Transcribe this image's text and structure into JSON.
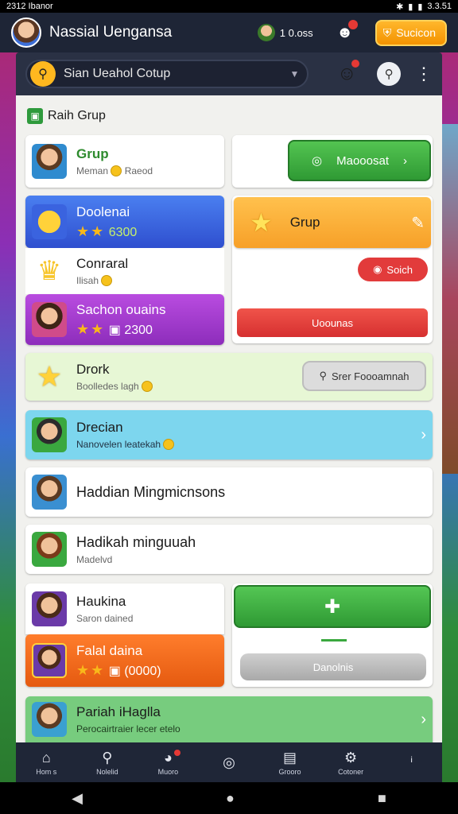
{
  "status_bar": {
    "time": "2312 Ibanor",
    "right": "3.3.51"
  },
  "header": {
    "title": "Nassial Uengansa",
    "coins": "1 0.oss",
    "action_label": "Sucicon"
  },
  "search": {
    "placeholder": "Sian Ueahol Cotup"
  },
  "section": {
    "title": "Raih Grup"
  },
  "cards": {
    "grup": {
      "title": "Grup",
      "subtitle": "Meman",
      "meta": "Raeod"
    },
    "masonat_button": "Maooosat",
    "doolenai": {
      "title": "Doolenai",
      "score": "6300"
    },
    "grup_orange": {
      "title": "Grup"
    },
    "conraral": {
      "title": "Conraral",
      "subtitle": "Ilisah"
    },
    "red_pill": "Soich",
    "sachon": {
      "title": "Sachon ouains",
      "score": "2300"
    },
    "red_button": "Uoounas",
    "drork": {
      "title": "Drork",
      "subtitle": "Boolledes lagh"
    },
    "search_pill": "Srer Foooamnah",
    "drecian": {
      "title": "Drecian",
      "subtitle": "Nanovelen leatekah"
    },
    "hadian": {
      "title": "Haddian Mingmicnsons"
    },
    "hadikah": {
      "title": "Hadikah minguuah",
      "subtitle": "Madelvd"
    },
    "haukina": {
      "title": "Haukina",
      "subtitle": "Saron dained"
    },
    "falal": {
      "title": "Falal daina",
      "score": "(0000)"
    },
    "grey_button": "Danolnis",
    "pariah": {
      "title": "Pariah iHaglla",
      "subtitle": "Perocairtraier lecer etelo"
    }
  },
  "nav": [
    {
      "label": "Hom s",
      "icon": "home-icon"
    },
    {
      "label": "Nolelid",
      "icon": "search-icon"
    },
    {
      "label": "Muoro",
      "icon": "chat-icon"
    },
    {
      "label": "",
      "icon": "compass-icon"
    },
    {
      "label": "Grooro",
      "icon": "box-icon"
    },
    {
      "label": "Cotoner",
      "icon": "gear-icon"
    },
    {
      "label": "",
      "icon": "info-icon"
    }
  ],
  "colors": {
    "green": "#3aa83f",
    "orange": "#ffab35",
    "blue": "#3a63df",
    "purple": "#a235c9",
    "red": "#e23b3b",
    "cyan": "#7dd6ee",
    "lime": "#e7f7d5",
    "teal_green": "#77cc7e"
  }
}
